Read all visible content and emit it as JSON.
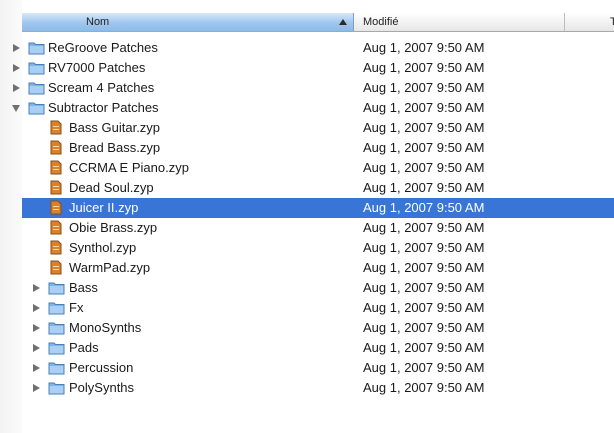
{
  "header": {
    "name_label": "Nom",
    "modified_label": "Modifié",
    "third_label": "T"
  },
  "rows": [
    {
      "name": "ReGroove Patches",
      "date": "Aug 1, 2007 9:50 AM"
    },
    {
      "name": "RV7000 Patches",
      "date": "Aug 1, 2007 9:50 AM"
    },
    {
      "name": "Scream 4 Patches",
      "date": "Aug 1, 2007 9:50 AM"
    },
    {
      "name": "Subtractor Patches",
      "date": "Aug 1, 2007 9:50 AM"
    },
    {
      "name": "Bass Guitar.zyp",
      "date": "Aug 1, 2007 9:50 AM"
    },
    {
      "name": "Bread Bass.zyp",
      "date": "Aug 1, 2007 9:50 AM"
    },
    {
      "name": "CCRMA E Piano.zyp",
      "date": "Aug 1, 2007 9:50 AM"
    },
    {
      "name": "Dead Soul.zyp",
      "date": "Aug 1, 2007 9:50 AM"
    },
    {
      "name": "Juicer II.zyp",
      "date": "Aug 1, 2007 9:50 AM"
    },
    {
      "name": "Obie Brass.zyp",
      "date": "Aug 1, 2007 9:50 AM"
    },
    {
      "name": "Synthol.zyp",
      "date": "Aug 1, 2007 9:50 AM"
    },
    {
      "name": "WarmPad.zyp",
      "date": "Aug 1, 2007 9:50 AM"
    },
    {
      "name": "Bass",
      "date": "Aug 1, 2007 9:50 AM"
    },
    {
      "name": "Fx",
      "date": "Aug 1, 2007 9:50 AM"
    },
    {
      "name": "MonoSynths",
      "date": "Aug 1, 2007 9:50 AM"
    },
    {
      "name": "Pads",
      "date": "Aug 1, 2007 9:50 AM"
    },
    {
      "name": "Percussion",
      "date": "Aug 1, 2007 9:50 AM"
    },
    {
      "name": "PolySynths",
      "date": "Aug 1, 2007 9:50 AM"
    }
  ],
  "colors": {
    "selection": "#3875d7",
    "header_sorted": "#9fc6ee",
    "folder": "#7fb2e5",
    "file": "#d9822b"
  }
}
